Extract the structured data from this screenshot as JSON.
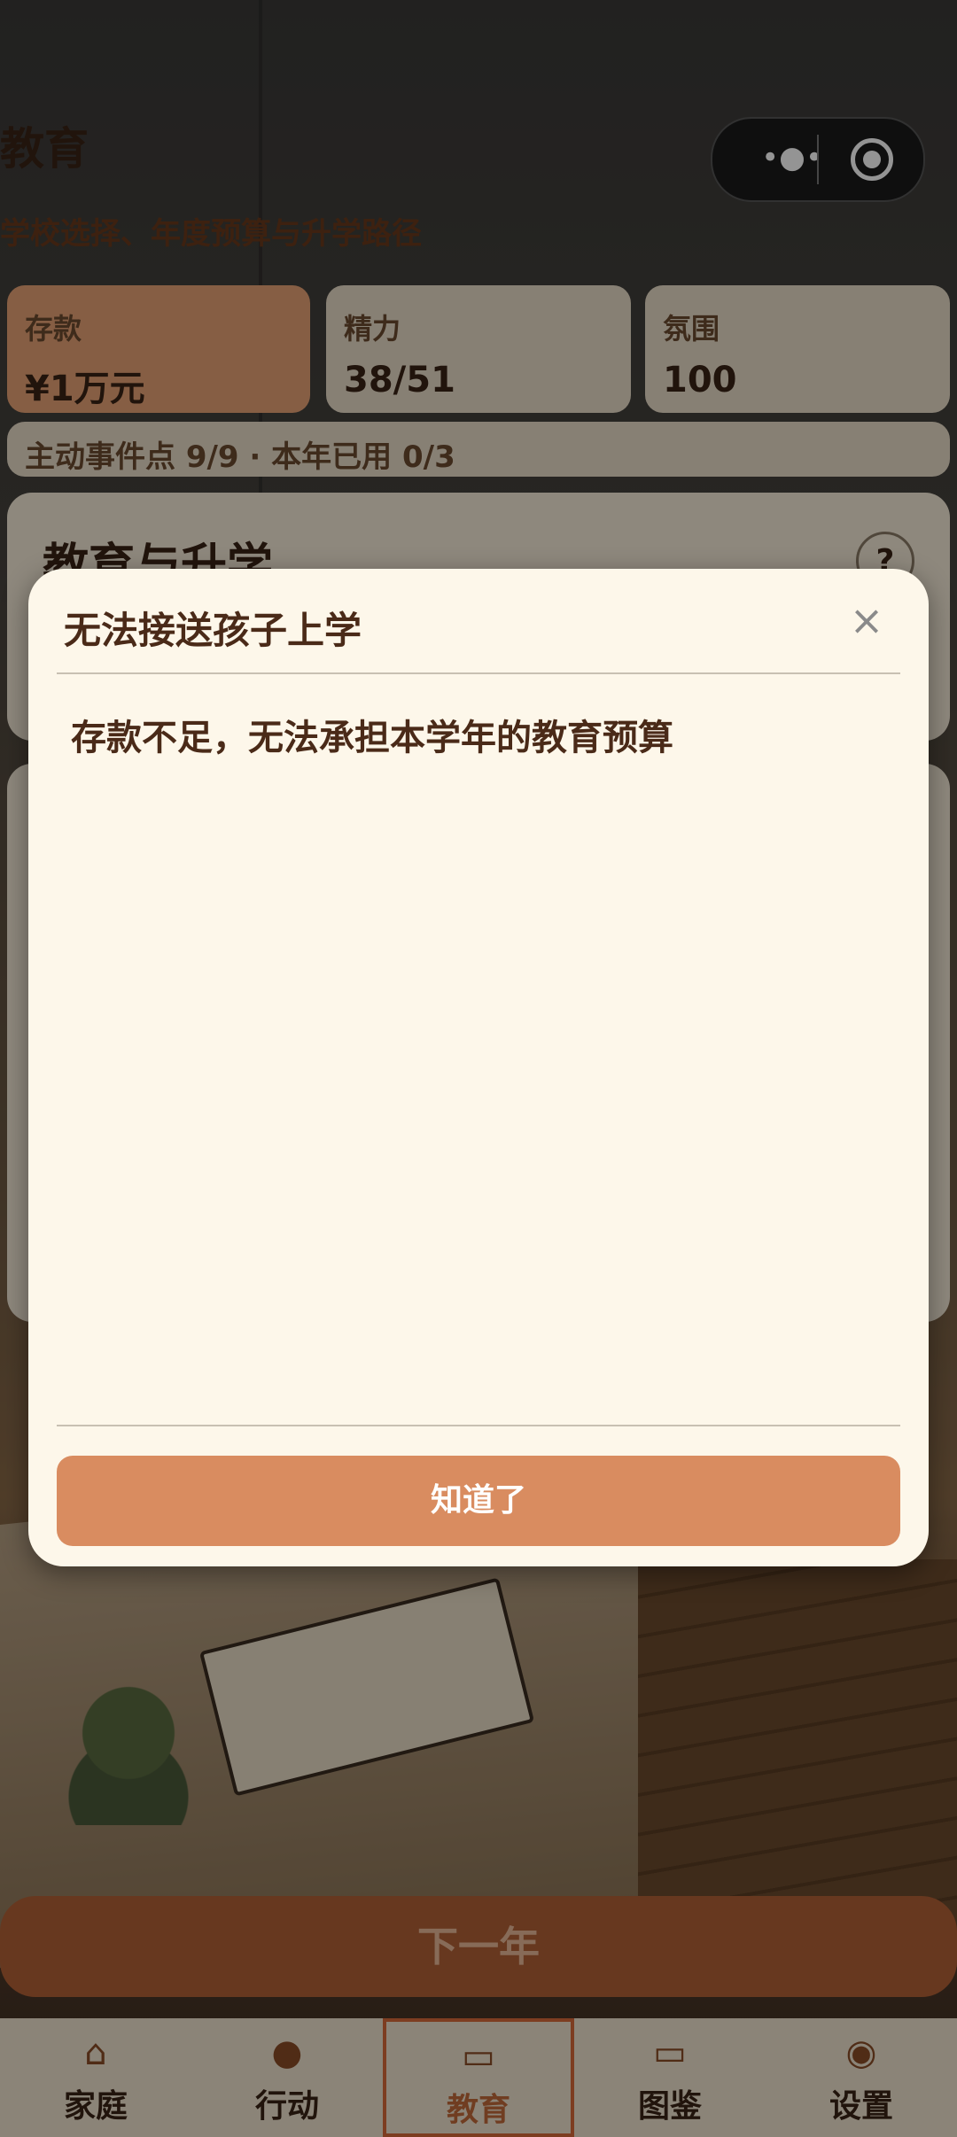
{
  "header": {
    "title": "教育",
    "subtitle": "学校选择、年度预算与升学路径"
  },
  "stats": [
    {
      "label": "存款",
      "value": "¥1万元"
    },
    {
      "label": "精力",
      "value": "38/51"
    },
    {
      "label": "氛围",
      "value": "100"
    }
  ],
  "events_bar": "主动事件点 9/9 · 本年已用 0/3",
  "panel": {
    "title": "教育与升学",
    "help": "?"
  },
  "modal": {
    "title": "无法接送孩子上学",
    "close": "×",
    "message": "存款不足，无法承担本学年的教育预算",
    "confirm": "知道了"
  },
  "next_year": "下一年",
  "tabs": [
    {
      "label": "家庭",
      "icon": "family-icon"
    },
    {
      "label": "行动",
      "icon": "action-icon"
    },
    {
      "label": "教育",
      "icon": "education-icon",
      "active": true
    },
    {
      "label": "图鉴",
      "icon": "collection-icon"
    },
    {
      "label": "设置",
      "icon": "settings-icon"
    }
  ],
  "capsule": {
    "more": "•●•"
  },
  "colors": {
    "accent": "#d98c60",
    "modal_bg": "#fdf7ea",
    "active_tab": "#d86a3a"
  }
}
